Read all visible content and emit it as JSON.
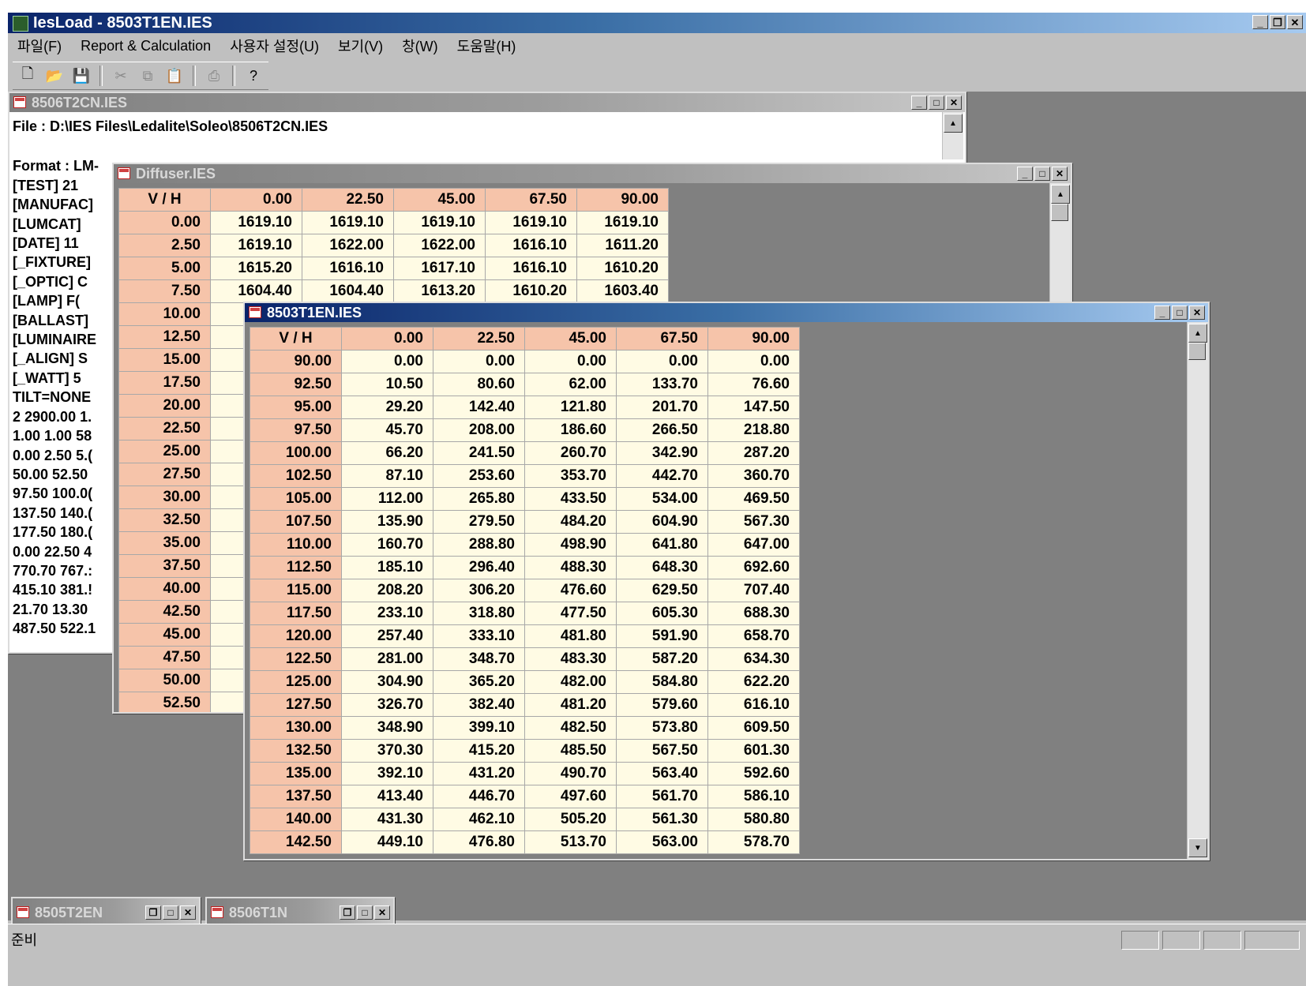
{
  "app": {
    "title": "IesLoad - 8503T1EN.IES"
  },
  "menu": [
    "파일(F)",
    "Report & Calculation",
    "사용자 설정(U)",
    "보기(V)",
    "창(W)",
    "도움말(H)"
  ],
  "toolbar_icons": [
    "new-file-icon",
    "open-folder-icon",
    "save-icon",
    "cut-icon",
    "copy-icon",
    "paste-icon",
    "print-icon",
    "help-icon"
  ],
  "win1": {
    "title": "8506T2CN.IES",
    "file_line": "File : D:\\IES Files\\Ledalite\\Soleo\\8506T2CN.IES",
    "lines": [
      "Format : LM-",
      "[TEST]     21",
      "[MANUFAC]",
      "[LUMCAT]",
      "[DATE]     11",
      "[_FIXTURE]",
      "[_OPTIC]   C",
      "[LAMP]     F(",
      "[BALLAST]",
      "[LUMINAIRE",
      "[_ALIGN]    S",
      "[_WATT]     5",
      "TILT=NONE",
      "2 2900.00 1.",
      "1.00 1.00 58",
      "0.00 2.50 5.(",
      "50.00 52.50",
      "97.50 100.0(",
      "137.50 140.(",
      "177.50 180.(",
      "0.00 22.50 4",
      "770.70 767.:",
      "415.10 381.!",
      "21.70 13.30",
      "487.50 522.1"
    ]
  },
  "win2": {
    "title": "Diffuser.IES",
    "headers": [
      "V / H",
      "0.00",
      "22.50",
      "45.00",
      "67.50",
      "90.00"
    ],
    "rows": [
      [
        "0.00",
        "1619.10",
        "1619.10",
        "1619.10",
        "1619.10",
        "1619.10"
      ],
      [
        "2.50",
        "1619.10",
        "1622.00",
        "1622.00",
        "1616.10",
        "1611.20"
      ],
      [
        "5.00",
        "1615.20",
        "1616.10",
        "1617.10",
        "1616.10",
        "1610.20"
      ],
      [
        "7.50",
        "1604.40",
        "1604.40",
        "1613.20",
        "1610.20",
        "1603.40"
      ],
      [
        "10.00",
        "1",
        "",
        "",
        "",
        ""
      ],
      [
        "12.50",
        "1",
        "",
        "",
        "",
        ""
      ],
      [
        "15.00",
        "1",
        "",
        "",
        "",
        ""
      ],
      [
        "17.50",
        "1",
        "",
        "",
        "",
        ""
      ],
      [
        "20.00",
        "1",
        "",
        "",
        "",
        ""
      ],
      [
        "22.50",
        "1",
        "",
        "",
        "",
        ""
      ],
      [
        "25.00",
        "1",
        "",
        "",
        "",
        ""
      ],
      [
        "27.50",
        "1",
        "",
        "",
        "",
        ""
      ],
      [
        "30.00",
        "1",
        "",
        "",
        "",
        ""
      ],
      [
        "32.50",
        "1",
        "",
        "",
        "",
        ""
      ],
      [
        "35.00",
        "1",
        "",
        "",
        "",
        ""
      ],
      [
        "37.50",
        "1",
        "",
        "",
        "",
        ""
      ],
      [
        "40.00",
        "1",
        "",
        "",
        "",
        ""
      ],
      [
        "42.50",
        "1",
        "",
        "",
        "",
        ""
      ],
      [
        "45.00",
        "",
        "",
        "",
        "",
        ""
      ],
      [
        "47.50",
        "",
        "",
        "",
        "",
        ""
      ],
      [
        "50.00",
        "",
        "",
        "",
        "",
        ""
      ],
      [
        "52.50",
        "",
        "",
        "",
        "",
        ""
      ]
    ]
  },
  "win3": {
    "title": "8503T1EN.IES",
    "headers": [
      "V / H",
      "0.00",
      "22.50",
      "45.00",
      "67.50",
      "90.00"
    ],
    "rows": [
      [
        "90.00",
        "0.00",
        "0.00",
        "0.00",
        "0.00",
        "0.00"
      ],
      [
        "92.50",
        "10.50",
        "80.60",
        "62.00",
        "133.70",
        "76.60"
      ],
      [
        "95.00",
        "29.20",
        "142.40",
        "121.80",
        "201.70",
        "147.50"
      ],
      [
        "97.50",
        "45.70",
        "208.00",
        "186.60",
        "266.50",
        "218.80"
      ],
      [
        "100.00",
        "66.20",
        "241.50",
        "260.70",
        "342.90",
        "287.20"
      ],
      [
        "102.50",
        "87.10",
        "253.60",
        "353.70",
        "442.70",
        "360.70"
      ],
      [
        "105.00",
        "112.00",
        "265.80",
        "433.50",
        "534.00",
        "469.50"
      ],
      [
        "107.50",
        "135.90",
        "279.50",
        "484.20",
        "604.90",
        "567.30"
      ],
      [
        "110.00",
        "160.70",
        "288.80",
        "498.90",
        "641.80",
        "647.00"
      ],
      [
        "112.50",
        "185.10",
        "296.40",
        "488.30",
        "648.30",
        "692.60"
      ],
      [
        "115.00",
        "208.20",
        "306.20",
        "476.60",
        "629.50",
        "707.40"
      ],
      [
        "117.50",
        "233.10",
        "318.80",
        "477.50",
        "605.30",
        "688.30"
      ],
      [
        "120.00",
        "257.40",
        "333.10",
        "481.80",
        "591.90",
        "658.70"
      ],
      [
        "122.50",
        "281.00",
        "348.70",
        "483.30",
        "587.20",
        "634.30"
      ],
      [
        "125.00",
        "304.90",
        "365.20",
        "482.00",
        "584.80",
        "622.20"
      ],
      [
        "127.50",
        "326.70",
        "382.40",
        "481.20",
        "579.60",
        "616.10"
      ],
      [
        "130.00",
        "348.90",
        "399.10",
        "482.50",
        "573.80",
        "609.50"
      ],
      [
        "132.50",
        "370.30",
        "415.20",
        "485.50",
        "567.50",
        "601.30"
      ],
      [
        "135.00",
        "392.10",
        "431.20",
        "490.70",
        "563.40",
        "592.60"
      ],
      [
        "137.50",
        "413.40",
        "446.70",
        "497.60",
        "561.70",
        "586.10"
      ],
      [
        "140.00",
        "431.30",
        "462.10",
        "505.20",
        "561.30",
        "580.80"
      ],
      [
        "142.50",
        "449.10",
        "476.80",
        "513.70",
        "563.00",
        "578.70"
      ]
    ]
  },
  "minimized": [
    {
      "title": "8505T2EN"
    },
    {
      "title": "8506T1N"
    }
  ],
  "status": {
    "text": "준비"
  }
}
